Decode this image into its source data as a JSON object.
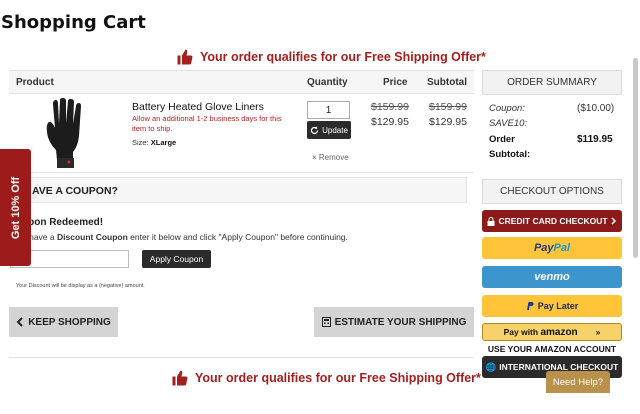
{
  "page": {
    "title": "Shopping Cart"
  },
  "promo": {
    "text": "Your order qualifies for our Free Shipping Offer*"
  },
  "cart": {
    "headers": {
      "product": "Product",
      "quantity": "Quantity",
      "price": "Price",
      "subtotal": "Subtotal"
    },
    "item": {
      "name": "Battery Heated Glove Liners",
      "note": "Allow an additional 1-2 business days for this item to ship.",
      "size_label": "Size:",
      "size_value": "XLarge",
      "quantity": "1",
      "update_label": "Update",
      "remove_label": "× Remove",
      "price_original": "$159.99",
      "price_sale": "$129.95",
      "subtotal_original": "$159.99",
      "subtotal_sale": "$129.95"
    }
  },
  "coupon": {
    "bar_label": "AVE A COUPON?",
    "redeemed_title": "upon Redeemed!",
    "instructions_pre": "u have a ",
    "instructions_bold": "Discount Coupon",
    "instructions_post": " enter it below and click \"Apply Coupon\" before continuing.",
    "apply_label": "Apply Coupon",
    "note": "Your Discount will be display as a (negative) amount."
  },
  "actions": {
    "keep_shopping": "KEEP SHOPPING",
    "estimate_shipping": "ESTIMATE YOUR SHIPPING"
  },
  "side_tab": {
    "label": "Get 10% Off"
  },
  "summary": {
    "header": "ORDER SUMMARY",
    "coupon_label": "Coupon:",
    "coupon_code": "SAVE10:",
    "coupon_value": "($10.00)",
    "subtotal_label_1": "Order",
    "subtotal_label_2": "Subtotal:",
    "subtotal_value": "$119.95"
  },
  "checkout": {
    "header": "CHECKOUT OPTIONS",
    "credit_card": "CREDIT CARD CHECKOUT",
    "paypal_1": "Pay",
    "paypal_2": "Pal",
    "venmo": "venmo",
    "pay_later": "Pay Later",
    "amazon_pre": "Pay with ",
    "amazon_brand": "amazon",
    "amazon_note": "USE YOUR AMAZON ACCOUNT",
    "international": "INTERNATIONAL CHECKOUT"
  },
  "help": {
    "label": "Need Help?"
  },
  "colors": {
    "accent_red": "#a32020",
    "paypal_yellow": "#ffc439",
    "venmo_blue": "#3d95ce",
    "help_gold": "#b9914a"
  }
}
